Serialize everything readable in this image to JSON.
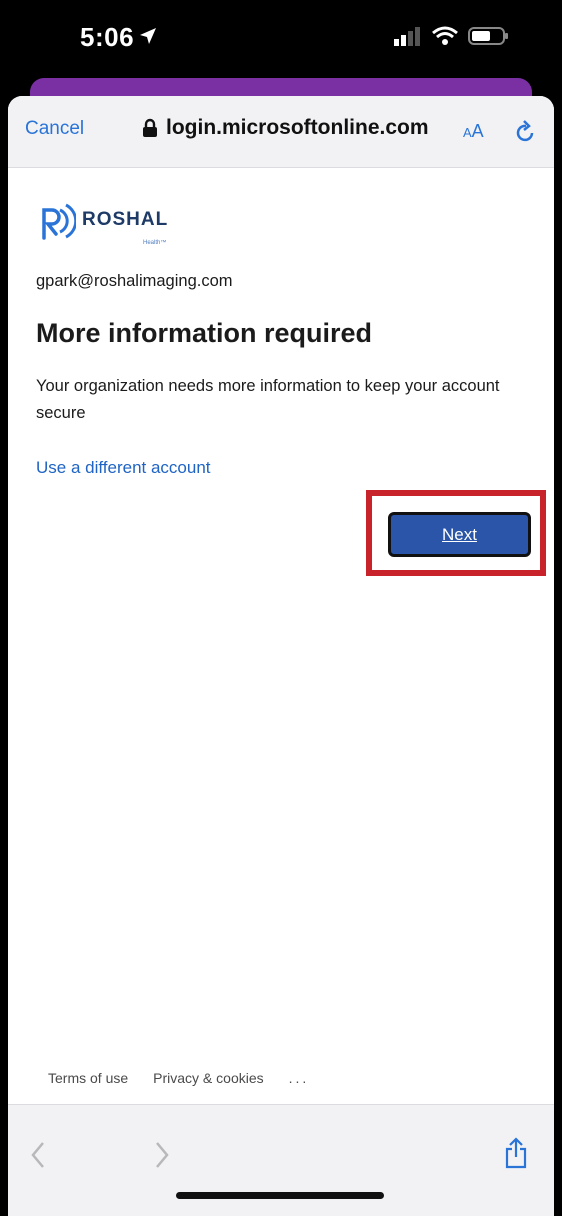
{
  "status_bar": {
    "time": "5:06",
    "icons": [
      "location-arrow-icon",
      "signal-icon",
      "wifi-icon",
      "battery-icon"
    ]
  },
  "browser": {
    "cancel_label": "Cancel",
    "url": "login.microsoftonline.com",
    "text_size_label_small": "A",
    "text_size_label_big": "A",
    "icons": [
      "lock-icon",
      "reload-icon"
    ]
  },
  "logo": {
    "name": "ROSHAL",
    "sub": "Health™"
  },
  "content": {
    "email": "gpark@roshalimaging.com",
    "title": "More information required",
    "description": "Your organization needs more information to keep your account secure",
    "different_account_link": "Use a different account",
    "next_label": "Next"
  },
  "footer": {
    "terms": "Terms of use",
    "privacy": "Privacy & cookies",
    "more": "..."
  },
  "colors": {
    "link": "#2a74d8",
    "button": "#2a55a8",
    "highlight": "#c8232b",
    "brand": "#1e3a67"
  }
}
